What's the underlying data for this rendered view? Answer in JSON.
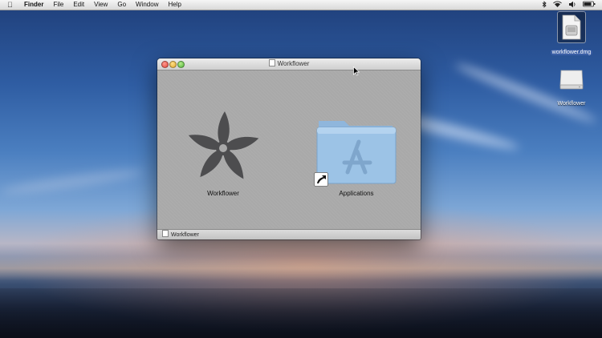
{
  "menubar": {
    "apple_icon": "apple-icon",
    "app_name": "Finder",
    "items": [
      "File",
      "Edit",
      "View",
      "Go",
      "Window",
      "Help"
    ],
    "status_icons": [
      "bluetooth-icon",
      "wifi-icon",
      "volume-icon",
      "battery-icon"
    ]
  },
  "desktop": {
    "icons": [
      {
        "label": "workflower.dmg",
        "icon": "dmg-file-icon",
        "selected": true
      },
      {
        "label": "Workflower",
        "icon": "mounted-disk-icon",
        "selected": false
      }
    ]
  },
  "window": {
    "title": "Workflower",
    "items": [
      {
        "label": "Workflower",
        "icon": "workflower-app-icon"
      },
      {
        "label": "Applications",
        "icon": "applications-folder-icon",
        "alias": true
      }
    ],
    "statusbar": "Workflower"
  },
  "colors": {
    "window_bg": "#a9a9a9",
    "folder_blue": "#8cb7e0",
    "app_icon": "#4d4d4f"
  }
}
